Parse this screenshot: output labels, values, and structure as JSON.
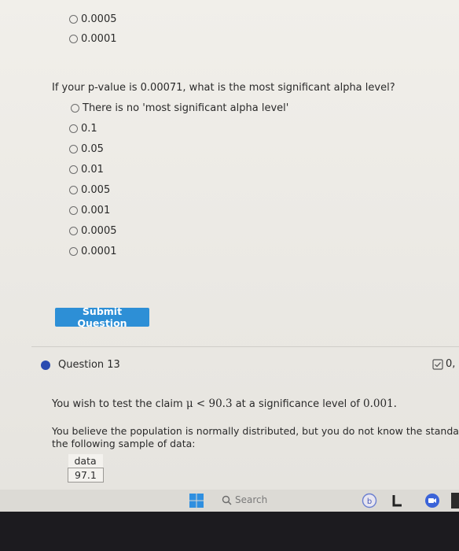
{
  "prev_question": {
    "options": [
      "0.0005",
      "0.0001"
    ]
  },
  "question": {
    "text": "If your p-value is 0.00071, what is the most significant alpha level?",
    "options": [
      "There is no 'most significant alpha level'",
      "0.1",
      "0.05",
      "0.01",
      "0.005",
      "0.001",
      "0.0005",
      "0.0001"
    ]
  },
  "submit_label": "Submit Question",
  "next_question": {
    "label": "Question 13",
    "score": "0,",
    "claim_prefix": "You wish to test the claim",
    "claim_math": "μ < 90.3",
    "claim_mid": "at a significance level of",
    "claim_alpha": "0.001.",
    "believe_line1": "You believe the population is normally distributed, but you do not know the standar",
    "believe_line2": "the following sample of data:",
    "table_header": "data",
    "table_values": [
      "97.1"
    ]
  },
  "taskbar": {
    "search_label": "Search"
  },
  "colors": {
    "submit_bg": "#2d8fd6",
    "question_dot": "#2a4bb0"
  }
}
